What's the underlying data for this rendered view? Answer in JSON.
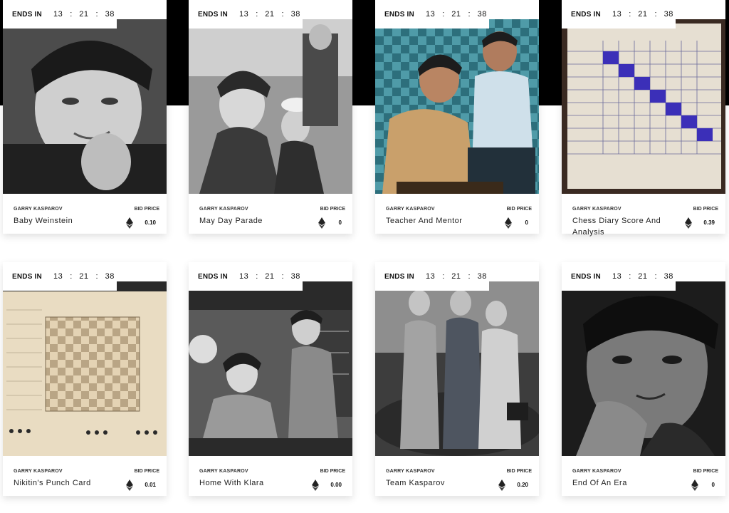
{
  "timer_label": "ENDS IN",
  "bid_label": "BID PRICE",
  "colors": {
    "band": "#000000",
    "card": "#ffffff",
    "accent": "#3b2fb8"
  },
  "cards": [
    {
      "artist": "GARRY KASPAROV",
      "title": "Baby Weinstein",
      "price": "0.10",
      "ends_in": {
        "h": "13",
        "m": "21",
        "s": "38"
      },
      "icon": "eth-icon"
    },
    {
      "artist": "GARRY KASPAROV",
      "title": "May Day Parade",
      "price": "0",
      "ends_in": {
        "h": "13",
        "m": "21",
        "s": "38"
      },
      "icon": "eth-icon"
    },
    {
      "artist": "GARRY KASPAROV",
      "title": "Teacher And Mentor",
      "price": "0",
      "ends_in": {
        "h": "13",
        "m": "21",
        "s": "38"
      },
      "icon": "eth-icon"
    },
    {
      "artist": "GARRY KASPAROV",
      "title": "Chess Diary Score And Analysis",
      "price": "0.39",
      "ends_in": {
        "h": "13",
        "m": "21",
        "s": "38"
      },
      "icon": "eth-icon"
    },
    {
      "artist": "GARRY KASPAROV",
      "title": "Nikitin's Punch Card",
      "price": "0.01",
      "ends_in": {
        "h": "13",
        "m": "21",
        "s": "38"
      },
      "icon": "eth-icon"
    },
    {
      "artist": "GARRY KASPAROV",
      "title": "Home With Klara",
      "price": "0.00",
      "ends_in": {
        "h": "13",
        "m": "21",
        "s": "38"
      },
      "icon": "eth-icon"
    },
    {
      "artist": "GARRY KASPAROV",
      "title": "Team Kasparov",
      "price": "0.20",
      "ends_in": {
        "h": "13",
        "m": "21",
        "s": "38"
      },
      "icon": "eth-icon"
    },
    {
      "artist": "GARRY KASPAROV",
      "title": "End Of An Era",
      "price": "0",
      "ends_in": {
        "h": "13",
        "m": "21",
        "s": "38"
      },
      "icon": "eth-icon"
    }
  ]
}
